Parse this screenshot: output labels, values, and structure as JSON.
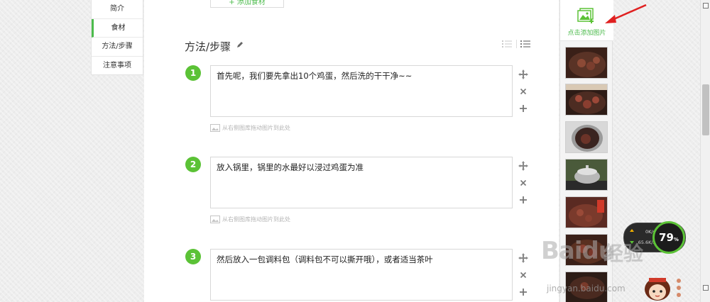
{
  "sidebar": {
    "items": [
      {
        "label": "简介"
      },
      {
        "label": "食材"
      },
      {
        "label": "方法/步骤"
      },
      {
        "label": "注意事项"
      }
    ]
  },
  "editor": {
    "add_ingredient_label": "+ 添加食材",
    "section_title": "方法/步骤",
    "drag_hint": "从右侧图库拖动图片到此处",
    "steps": [
      {
        "number": "1",
        "text": "首先呢，我们要先拿出10个鸡蛋，然后洗的干干净~~"
      },
      {
        "number": "2",
        "text": "放入锅里，锅里的水最好以浸过鸡蛋为准"
      },
      {
        "number": "3",
        "text": "然后放入一包调料包（调料包不可以撕开哦），或者适当茶叶"
      }
    ]
  },
  "image_panel": {
    "add_label": "点击添加图片",
    "thumb_count": 7
  },
  "net_widget": {
    "upload": "0K/s",
    "download": "65.6K/s",
    "memory_percent": "79",
    "percent_sign": "%"
  },
  "watermark": {
    "brand": "Baidu",
    "subbrand": "经验",
    "url": "jingyan.baidu.com"
  },
  "colors": {
    "accent_green": "#5bc236",
    "annotation_red": "#e02020"
  }
}
